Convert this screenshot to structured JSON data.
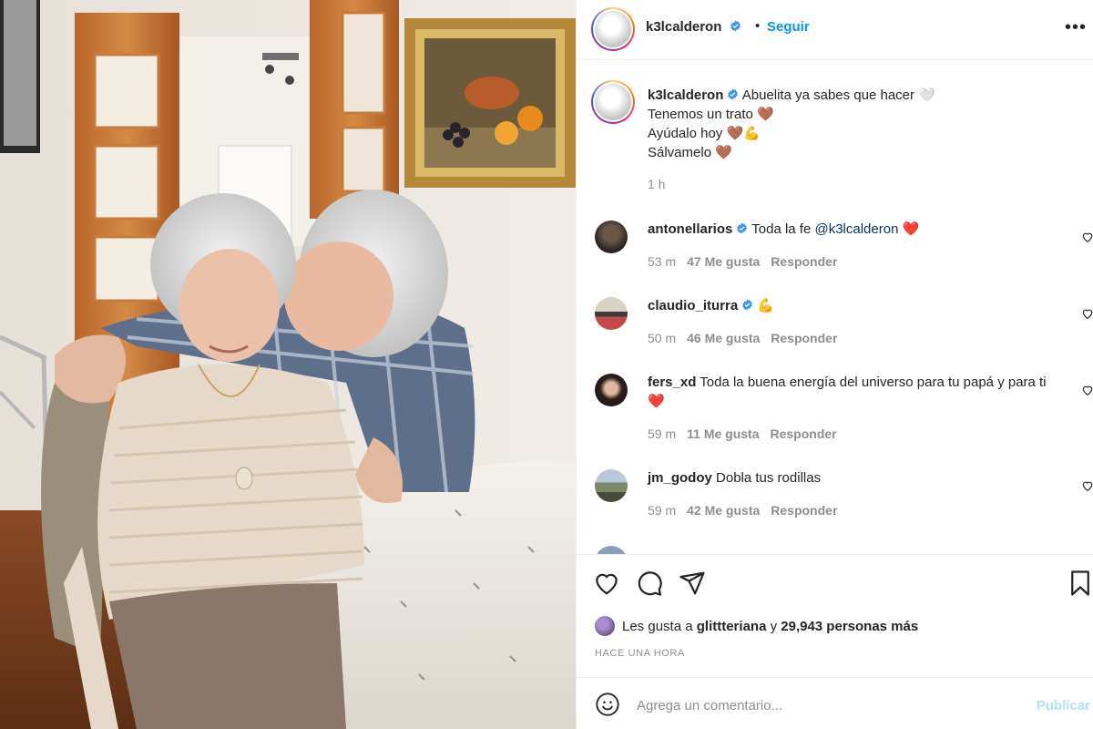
{
  "post": {
    "username": "k3lcalderon",
    "separator": "•",
    "follow_label": "Seguir",
    "more_icon": "more-horizontal-icon",
    "caption": {
      "line1": "Abuelita ya sabes que hacer 🤍",
      "line2": "Tenemos un trato 🤎",
      "line3": "Ayúdalo hoy 🤎💪",
      "line4": "Sálvamelo 🤎",
      "time": "1 h"
    }
  },
  "comments": [
    {
      "username": "antonellarios",
      "verified": true,
      "text_before": "Toda la fe ",
      "mention": "@k3lcalderon",
      "text_after": " ❤️",
      "time": "53 m",
      "likes": "47 Me gusta",
      "reply": "Responder"
    },
    {
      "username": "claudio_iturra",
      "verified": true,
      "text": "💪",
      "time": "50 m",
      "likes": "46 Me gusta",
      "reply": "Responder"
    },
    {
      "username": "fers_xd",
      "verified": false,
      "text": "Toda la buena energía del universo para tu papá y para ti ❤️",
      "time": "59 m",
      "likes": "11 Me gusta",
      "reply": "Responder"
    },
    {
      "username": "jm_godoy",
      "verified": false,
      "text": "Dobla tus rodillas",
      "time": "59 m",
      "likes": "42 Me gusta",
      "reply": "Responder"
    }
  ],
  "actions": {
    "like_icon": "heart-icon",
    "comment_icon": "comment-icon",
    "share_icon": "send-icon",
    "save_icon": "bookmark-icon",
    "likes_prefix": "Les gusta a ",
    "likes_user": "glittteriana",
    "likes_mid": " y ",
    "likes_count": "29,943 personas más",
    "time_ago": "HACE UNA HORA"
  },
  "add_comment": {
    "emoji_icon": "emoji-smile-icon",
    "placeholder": "Agrega un comentario...",
    "publish_label": "Publicar"
  },
  "colors": {
    "link_blue": "#0095f6",
    "publish_disabled": "#b2dffc",
    "secondary_text": "#8e8e8e",
    "verified_blue": "#3897f0"
  }
}
